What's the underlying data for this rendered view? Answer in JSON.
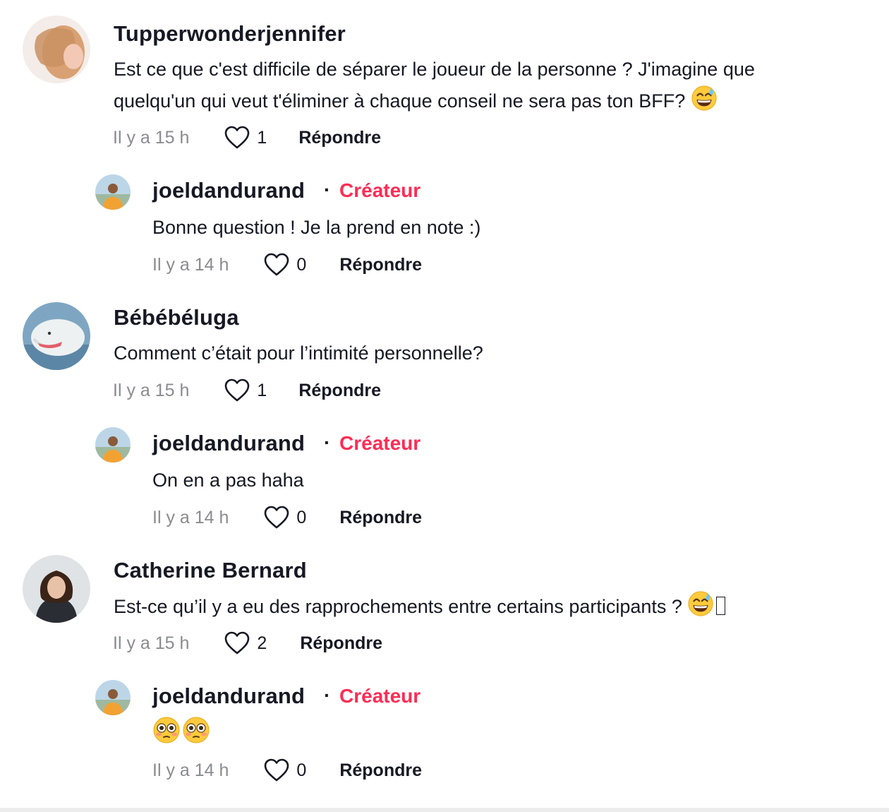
{
  "comments": [
    {
      "user": "Tupperwonderjennifer",
      "text_line1": "Est ce que c'est difficile de séparer le joueur de la personne ? J'imagine que",
      "text_line2": "quelqu'un qui veut t'éliminer à chaque conseil ne sera pas ton BFF?",
      "time": "Il y a 15 h",
      "likes": "1",
      "reply_label": "Répondre",
      "reply": {
        "user": "joeldandurand",
        "badge": "Créateur",
        "text": "Bonne question ! Je la prend en note :)",
        "time": "Il y a 14 h",
        "likes": "0",
        "reply_label": "Répondre"
      }
    },
    {
      "user": "Bébébéluga",
      "text_line1": "Comment c’était pour l’intimité personnelle?",
      "time": "Il y a 15 h",
      "likes": "1",
      "reply_label": "Répondre",
      "reply": {
        "user": "joeldandurand",
        "badge": "Créateur",
        "text": "On en a pas haha",
        "time": "Il y a 14 h",
        "likes": "0",
        "reply_label": "Répondre"
      }
    },
    {
      "user": "Catherine Bernard",
      "text_line1": "Est-ce qu’il y a eu des rapprochements entre certains participants ?",
      "time": "Il y a 15 h",
      "likes": "2",
      "reply_label": "Répondre",
      "reply": {
        "user": "joeldandurand",
        "badge": "Créateur",
        "text": "",
        "time": "Il y a 14 h",
        "likes": "0",
        "reply_label": "Répondre"
      }
    }
  ],
  "separator": "·",
  "icons": {
    "like": "heart-outline-icon",
    "emoji_sweat": "grinning-sweat-emoji",
    "emoji_flushed": "flushed-face-emoji"
  },
  "colors": {
    "creator_badge": "#fe2c55",
    "text": "#161823",
    "muted": "#8a8b91"
  }
}
